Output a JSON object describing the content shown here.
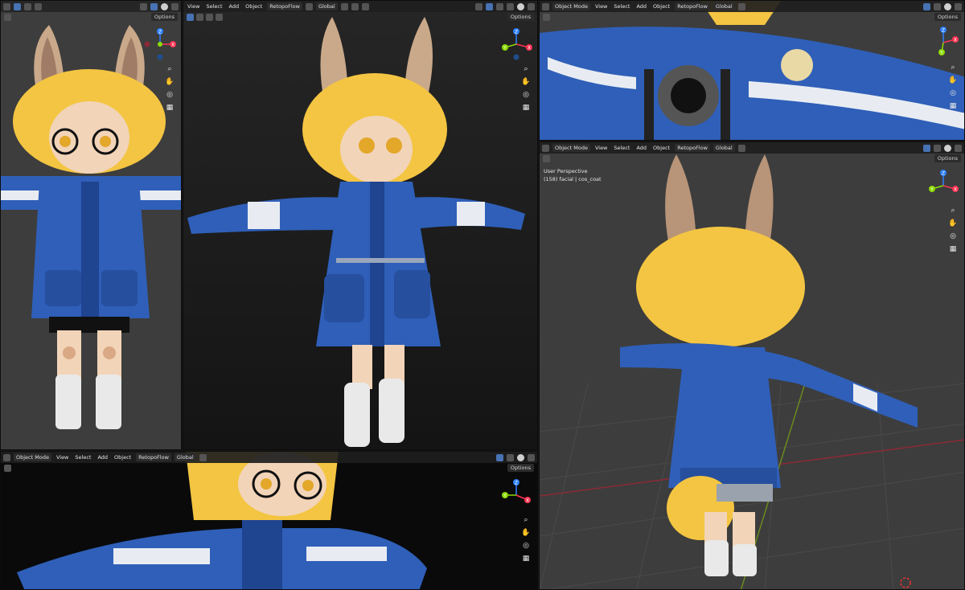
{
  "header": {
    "options_label": "Options",
    "menu": [
      "View",
      "Select",
      "Add",
      "Object"
    ],
    "mode_label": "Object Mode",
    "addon_label": "RetopoFlow",
    "transform_label": "Global"
  },
  "viewport_persp": {
    "view_name": "User Perspective",
    "collection": "(158) facial | cos_coat"
  },
  "gizmo": {
    "x": "X",
    "y": "Y",
    "z": "Z"
  },
  "tools": [
    "zoom-icon",
    "hand-icon",
    "camera-icon",
    "grid-icon"
  ],
  "colors": {
    "coat_blue": "#2f5fb8",
    "coat_dark": "#1f4490",
    "hair_yellow": "#f4c542",
    "ear_tan": "#c9a98a",
    "stripe_white": "#e8ecf2",
    "boot_white": "#e9e9e9",
    "skin": "#f2d4b8",
    "accent_blue": "#4772b3",
    "viewport_gray": "#3d3d3d"
  }
}
